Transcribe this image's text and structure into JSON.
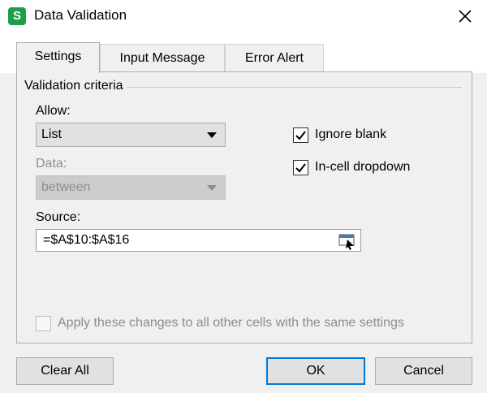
{
  "window": {
    "title": "Data Validation",
    "app_icon_letter": "S"
  },
  "tabs": [
    {
      "label": "Settings",
      "active": true
    },
    {
      "label": "Input Message",
      "active": false
    },
    {
      "label": "Error Alert",
      "active": false
    }
  ],
  "settings": {
    "group_title": "Validation criteria",
    "allow": {
      "label": "Allow:",
      "value": "List"
    },
    "data": {
      "label": "Data:",
      "value": "between",
      "disabled": true
    },
    "source": {
      "label": "Source:",
      "value": "=$A$10:$A$16"
    },
    "ignore_blank": {
      "label": "Ignore blank",
      "checked": true
    },
    "in_cell_dropdown": {
      "label": "In-cell dropdown",
      "checked": true
    },
    "apply_all": {
      "label": "Apply these changes to all other cells with the same settings",
      "checked": false,
      "disabled": true
    }
  },
  "buttons": {
    "clear_all": "Clear All",
    "ok": "OK",
    "cancel": "Cancel"
  },
  "colors": {
    "accent": "#0078d7",
    "app_icon": "#1e9e4a"
  }
}
